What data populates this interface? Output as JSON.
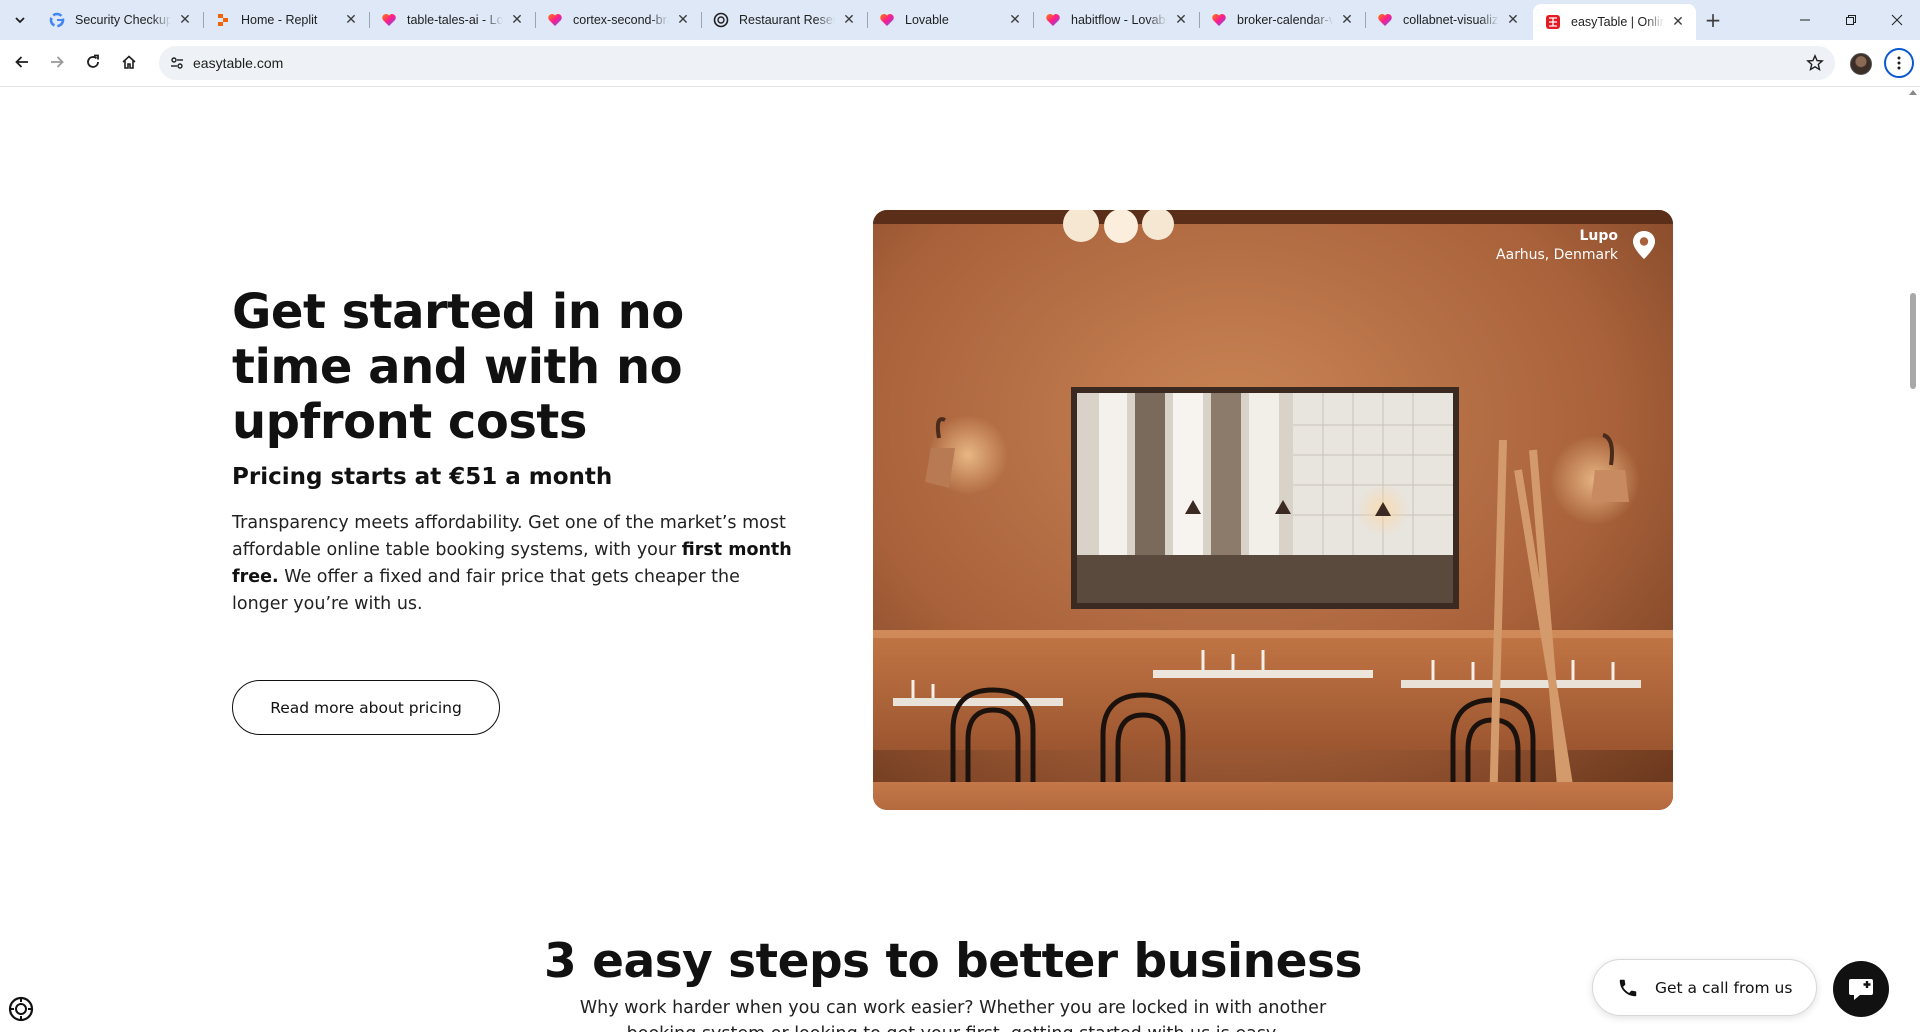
{
  "browser": {
    "tabs": [
      {
        "title": "Security Checkup",
        "favicon": "google-icon",
        "active": false
      },
      {
        "title": "Home - Replit",
        "favicon": "replit-icon",
        "active": false
      },
      {
        "title": "table-tales-ai - Lovable",
        "favicon": "lovable-icon",
        "active": false
      },
      {
        "title": "cortex-second-brain",
        "favicon": "lovable-icon",
        "active": false
      },
      {
        "title": "Restaurant Reservation",
        "favicon": "openai-icon",
        "active": false
      },
      {
        "title": "Lovable",
        "favicon": "lovable-icon",
        "active": false
      },
      {
        "title": "habitflow - Lovable",
        "favicon": "lovable-icon",
        "active": false
      },
      {
        "title": "broker-calendar-view",
        "favicon": "lovable-icon",
        "active": false
      },
      {
        "title": "collabnet-visualizer",
        "favicon": "lovable-icon",
        "active": false
      },
      {
        "title": "easyTable | Online",
        "favicon": "easytable-icon",
        "active": true
      }
    ],
    "url": "easytable.com",
    "accent": "#0b57d0"
  },
  "page": {
    "hero": {
      "heading": "Get started in no time and with no upfront costs",
      "subheading": "Pricing starts at €51 a month",
      "body_part1": "Transparency meets affordability. Get one of the market’s most affordable online table booking systems, with your ",
      "body_bold": "first month free.",
      "body_part2": " We offer a fixed and fair price that gets cheaper the longer you’re with us.",
      "button": "Read more about pricing"
    },
    "photo": {
      "name": "Lupo",
      "location": "Aarhus, Denmark"
    },
    "steps": {
      "heading": "3 easy steps to better business",
      "body": "Why work harder when you can work easier? Whether you are locked in with another booking system or looking to get your first, getting started with us is easy."
    },
    "widgets": {
      "call_button": "Get a call from us"
    }
  }
}
